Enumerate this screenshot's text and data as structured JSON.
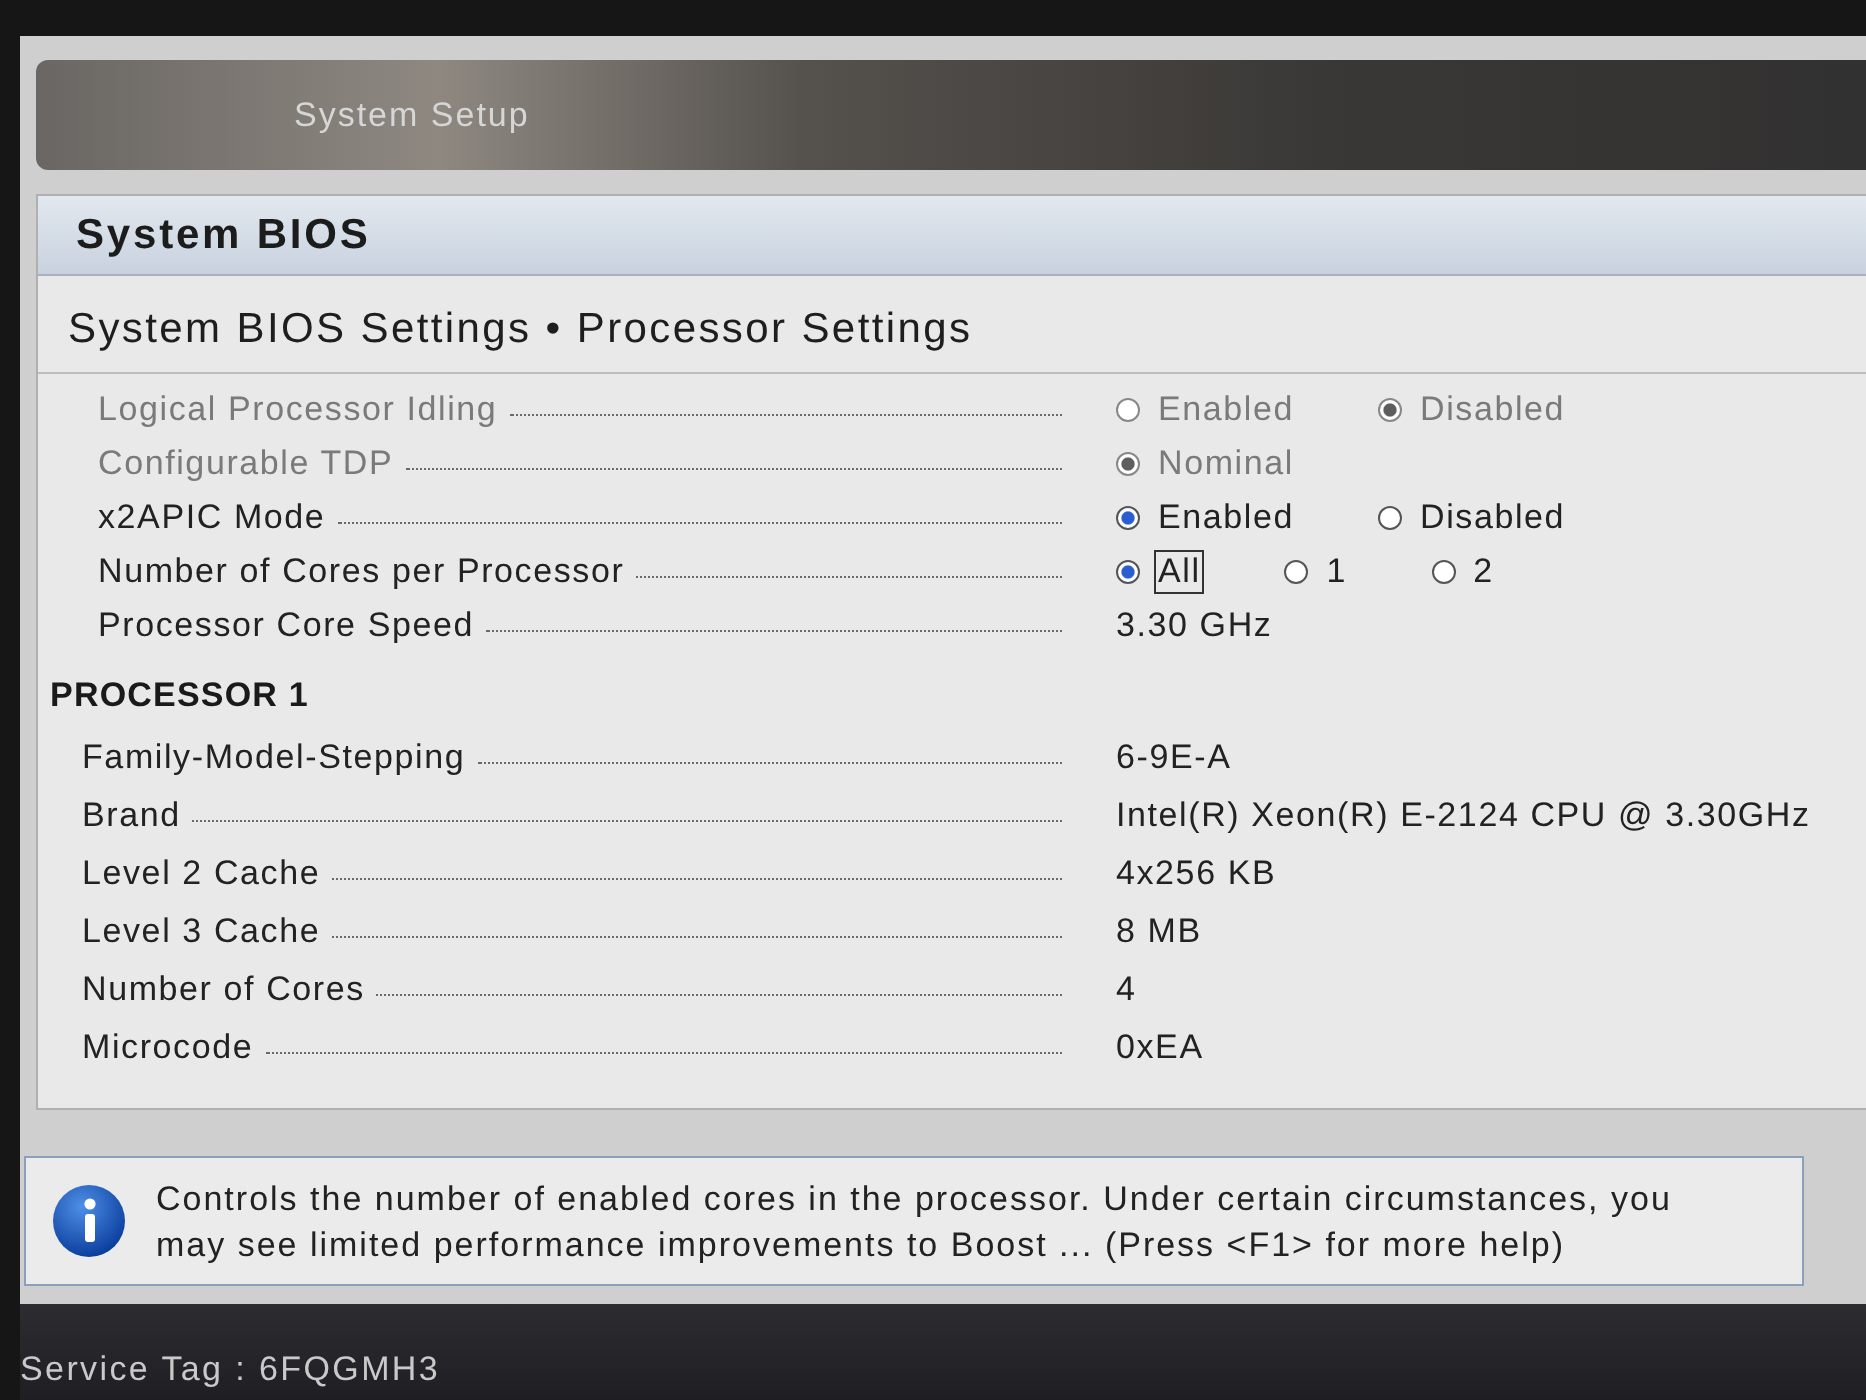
{
  "header": {
    "title": "System Setup"
  },
  "panel": {
    "title": "System BIOS",
    "breadcrumb": "System BIOS Settings • Processor Settings"
  },
  "settings": [
    {
      "label": "Logical Processor Idling",
      "kind": "radio",
      "disabled": true,
      "options": [
        {
          "label": "Enabled",
          "selected": false,
          "focused": false
        },
        {
          "label": "Disabled",
          "selected": true,
          "focused": false
        }
      ]
    },
    {
      "label": "Configurable TDP",
      "kind": "radio",
      "disabled": true,
      "options": [
        {
          "label": "Nominal",
          "selected": true,
          "focused": false
        }
      ]
    },
    {
      "label": "x2APIC Mode",
      "kind": "radio",
      "disabled": false,
      "options": [
        {
          "label": "Enabled",
          "selected": true,
          "focused": false
        },
        {
          "label": "Disabled",
          "selected": false,
          "focused": false
        }
      ]
    },
    {
      "label": "Number of Cores per Processor",
      "kind": "radio",
      "disabled": false,
      "options": [
        {
          "label": "All",
          "selected": true,
          "focused": true
        },
        {
          "label": "1",
          "selected": false,
          "focused": false
        },
        {
          "label": "2",
          "selected": false,
          "focused": false
        }
      ]
    },
    {
      "label": "Processor Core Speed",
      "kind": "text",
      "disabled": false,
      "value": "3.30 GHz"
    }
  ],
  "processor": {
    "title": "PROCESSOR 1",
    "rows": [
      {
        "label": "Family-Model-Stepping",
        "value": "6-9E-A"
      },
      {
        "label": "Brand",
        "value": "Intel(R) Xeon(R) E-2124 CPU @ 3.30GHz"
      },
      {
        "label": "Level 2 Cache",
        "value": "4x256 KB"
      },
      {
        "label": "Level 3 Cache",
        "value": "8 MB"
      },
      {
        "label": "Number of Cores",
        "value": "4"
      },
      {
        "label": "Microcode",
        "value": "0xEA"
      }
    ]
  },
  "help": {
    "text": "Controls the number of enabled cores in the processor. Under certain circumstances, you may see limited performance improvements to Boost ... (Press <F1> for more help)"
  },
  "footer": {
    "service_tag": "Service Tag : 6FQGMH3"
  }
}
